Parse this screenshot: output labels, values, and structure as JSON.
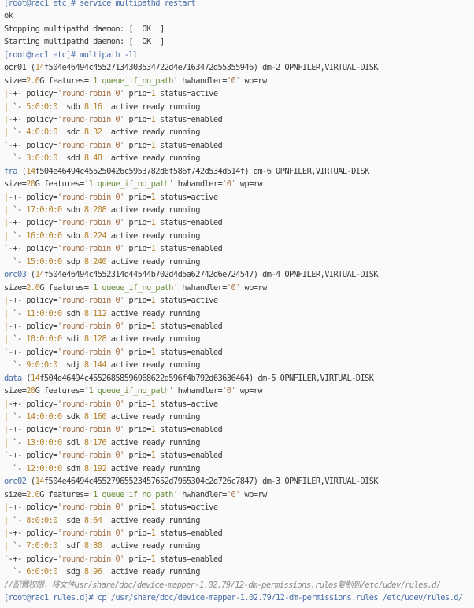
{
  "terminal": {
    "lines": [
      [
        [
          "[root@rac1 etc]# service multipathd restart",
          "p"
        ]
      ],
      [
        [
          "ok",
          "d"
        ]
      ],
      [
        [
          "Stopping multipathd daemon: [  OK  ]",
          "d"
        ]
      ],
      [
        [
          "Starting multipathd daemon: [  OK  ]",
          "d"
        ]
      ],
      [
        [
          "[root@rac1 etc]# multipath -ll",
          "p"
        ]
      ],
      [
        [
          "ocr01 (",
          "d"
        ],
        [
          "14",
          "n"
        ],
        [
          "f504e46494c45527134303534722d4e7163472d55355946) dm-2 OPNFILER,VIRTUAL-DISK",
          "d"
        ]
      ],
      [
        [
          "size=",
          "d"
        ],
        [
          "2.0",
          "n"
        ],
        [
          "G features=",
          "d"
        ],
        [
          "'",
          "q"
        ],
        [
          "1 queue_if_no_path",
          "s"
        ],
        [
          "'",
          "q"
        ],
        [
          " hwhandler=",
          "d"
        ],
        [
          "'0'",
          "q"
        ],
        [
          " wp=rw",
          "d"
        ]
      ],
      [
        [
          "|",
          "b"
        ],
        [
          "-+- policy=",
          "d"
        ],
        [
          "'round-robin 0'",
          "q"
        ],
        [
          " prio=",
          "d"
        ],
        [
          "1",
          "n"
        ],
        [
          " status=active",
          "d"
        ]
      ],
      [
        [
          "|",
          "b"
        ],
        [
          " `- ",
          "d"
        ],
        [
          "5:0:0:0",
          "n"
        ],
        [
          "  sdb ",
          "d"
        ],
        [
          "8:16",
          "n"
        ],
        [
          "  active ready running",
          "d"
        ]
      ],
      [
        [
          "|",
          "b"
        ],
        [
          "-+- policy=",
          "d"
        ],
        [
          "'round-robin 0'",
          "q"
        ],
        [
          " prio=",
          "d"
        ],
        [
          "1",
          "n"
        ],
        [
          " status=enabled",
          "d"
        ]
      ],
      [
        [
          "|",
          "b"
        ],
        [
          " `- ",
          "d"
        ],
        [
          "4:0:0:0",
          "n"
        ],
        [
          "  sdc ",
          "d"
        ],
        [
          "8:32",
          "n"
        ],
        [
          "  active ready running",
          "d"
        ]
      ],
      [
        [
          "`-+- policy=",
          "d"
        ],
        [
          "'round-robin 0'",
          "q"
        ],
        [
          " prio=",
          "d"
        ],
        [
          "1",
          "n"
        ],
        [
          " status=enabled",
          "d"
        ]
      ],
      [
        [
          "  `- ",
          "d"
        ],
        [
          "3:0:0:0",
          "n"
        ],
        [
          "  sdd ",
          "d"
        ],
        [
          "8:48",
          "n"
        ],
        [
          "  active ready running",
          "d"
        ]
      ],
      [
        [
          "fra",
          "p"
        ],
        [
          " (",
          "d"
        ],
        [
          "14",
          "n"
        ],
        [
          "f504e46494c455250426c5953782d6f586f742d534d514f) dm-6 OPNFILER,VIRTUAL-DISK",
          "d"
        ]
      ],
      [
        [
          "size=",
          "d"
        ],
        [
          "20",
          "n"
        ],
        [
          "G features=",
          "d"
        ],
        [
          "'",
          "q"
        ],
        [
          "1 queue_if_no_path",
          "s"
        ],
        [
          "'",
          "q"
        ],
        [
          " hwhandler=",
          "d"
        ],
        [
          "'0'",
          "q"
        ],
        [
          " wp=rw",
          "d"
        ]
      ],
      [
        [
          "|",
          "b"
        ],
        [
          "-+- policy=",
          "d"
        ],
        [
          "'round-robin 0'",
          "q"
        ],
        [
          " prio=",
          "d"
        ],
        [
          "1",
          "n"
        ],
        [
          " status=active",
          "d"
        ]
      ],
      [
        [
          "|",
          "b"
        ],
        [
          " `- ",
          "d"
        ],
        [
          "17:0:0:0",
          "n"
        ],
        [
          " sdn ",
          "d"
        ],
        [
          "8:208",
          "n"
        ],
        [
          " active ready running",
          "d"
        ]
      ],
      [
        [
          "|",
          "b"
        ],
        [
          "-+- policy=",
          "d"
        ],
        [
          "'round-robin 0'",
          "q"
        ],
        [
          " prio=",
          "d"
        ],
        [
          "1",
          "n"
        ],
        [
          " status=enabled",
          "d"
        ]
      ],
      [
        [
          "|",
          "b"
        ],
        [
          " `- ",
          "d"
        ],
        [
          "16:0:0:0",
          "n"
        ],
        [
          " sdo ",
          "d"
        ],
        [
          "8:224",
          "n"
        ],
        [
          " active ready running",
          "d"
        ]
      ],
      [
        [
          "`-+- policy=",
          "d"
        ],
        [
          "'round-robin 0'",
          "q"
        ],
        [
          " prio=",
          "d"
        ],
        [
          "1",
          "n"
        ],
        [
          " status=enabled",
          "d"
        ]
      ],
      [
        [
          "  `- ",
          "d"
        ],
        [
          "15:0:0:0",
          "n"
        ],
        [
          " sdp ",
          "d"
        ],
        [
          "8:240",
          "n"
        ],
        [
          " active ready running",
          "d"
        ]
      ],
      [
        [
          "orc03",
          "p"
        ],
        [
          " (",
          "d"
        ],
        [
          "14",
          "n"
        ],
        [
          "f504e46494c4552314d44544b702d4d5a62742d6e724547) dm-4 OPNFILER,VIRTUAL-DISK",
          "d"
        ]
      ],
      [
        [
          "size=",
          "d"
        ],
        [
          "2.0",
          "n"
        ],
        [
          "G features=",
          "d"
        ],
        [
          "'",
          "q"
        ],
        [
          "1 queue_if_no_path",
          "s"
        ],
        [
          "'",
          "q"
        ],
        [
          " hwhandler=",
          "d"
        ],
        [
          "'0'",
          "q"
        ],
        [
          " wp=rw",
          "d"
        ]
      ],
      [
        [
          "|",
          "b"
        ],
        [
          "-+- policy=",
          "d"
        ],
        [
          "'round-robin 0'",
          "q"
        ],
        [
          " prio=",
          "d"
        ],
        [
          "1",
          "n"
        ],
        [
          " status=active",
          "d"
        ]
      ],
      [
        [
          "|",
          "b"
        ],
        [
          " `- ",
          "d"
        ],
        [
          "11:0:0:0",
          "n"
        ],
        [
          " sdh ",
          "d"
        ],
        [
          "8:112",
          "n"
        ],
        [
          " active ready running",
          "d"
        ]
      ],
      [
        [
          "|",
          "b"
        ],
        [
          "-+- policy=",
          "d"
        ],
        [
          "'round-robin 0'",
          "q"
        ],
        [
          " prio=",
          "d"
        ],
        [
          "1",
          "n"
        ],
        [
          " status=enabled",
          "d"
        ]
      ],
      [
        [
          "|",
          "b"
        ],
        [
          " `- ",
          "d"
        ],
        [
          "10:0:0:0",
          "n"
        ],
        [
          " sdi ",
          "d"
        ],
        [
          "8:128",
          "n"
        ],
        [
          " active ready running",
          "d"
        ]
      ],
      [
        [
          "`-+- policy=",
          "d"
        ],
        [
          "'round-robin 0'",
          "q"
        ],
        [
          " prio=",
          "d"
        ],
        [
          "1",
          "n"
        ],
        [
          " status=enabled",
          "d"
        ]
      ],
      [
        [
          "  `- ",
          "d"
        ],
        [
          "9:0:0:0",
          "n"
        ],
        [
          "  sdj ",
          "d"
        ],
        [
          "8:144",
          "n"
        ],
        [
          " active ready running",
          "d"
        ]
      ],
      [
        [
          "data",
          "p"
        ],
        [
          " (",
          "d"
        ],
        [
          "14",
          "n"
        ],
        [
          "f504e46494c45526858596968622d596f4b792d63636464) dm-5 OPNFILER,VIRTUAL-DISK",
          "d"
        ]
      ],
      [
        [
          "size=",
          "d"
        ],
        [
          "20",
          "n"
        ],
        [
          "G features=",
          "d"
        ],
        [
          "'",
          "q"
        ],
        [
          "1 queue_if_no_path",
          "s"
        ],
        [
          "'",
          "q"
        ],
        [
          " hwhandler=",
          "d"
        ],
        [
          "'0'",
          "q"
        ],
        [
          " wp=rw",
          "d"
        ]
      ],
      [
        [
          "|",
          "b"
        ],
        [
          "-+- policy=",
          "d"
        ],
        [
          "'round-robin 0'",
          "q"
        ],
        [
          " prio=",
          "d"
        ],
        [
          "1",
          "n"
        ],
        [
          " status=active",
          "d"
        ]
      ],
      [
        [
          "|",
          "b"
        ],
        [
          " `- ",
          "d"
        ],
        [
          "14:0:0:0",
          "n"
        ],
        [
          " sdk ",
          "d"
        ],
        [
          "8:160",
          "n"
        ],
        [
          " active ready running",
          "d"
        ]
      ],
      [
        [
          "|",
          "b"
        ],
        [
          "-+- policy=",
          "d"
        ],
        [
          "'round-robin 0'",
          "q"
        ],
        [
          " prio=",
          "d"
        ],
        [
          "1",
          "n"
        ],
        [
          " status=enabled",
          "d"
        ]
      ],
      [
        [
          "|",
          "b"
        ],
        [
          " `- ",
          "d"
        ],
        [
          "13:0:0:0",
          "n"
        ],
        [
          " sdl ",
          "d"
        ],
        [
          "8:176",
          "n"
        ],
        [
          " active ready running",
          "d"
        ]
      ],
      [
        [
          "`-+- policy=",
          "d"
        ],
        [
          "'round-robin 0'",
          "q"
        ],
        [
          " prio=",
          "d"
        ],
        [
          "1",
          "n"
        ],
        [
          " status=enabled",
          "d"
        ]
      ],
      [
        [
          "  `- ",
          "d"
        ],
        [
          "12:0:0:0",
          "n"
        ],
        [
          " sdm ",
          "d"
        ],
        [
          "8:192",
          "n"
        ],
        [
          " active ready running",
          "d"
        ]
      ],
      [
        [
          "orc02",
          "p"
        ],
        [
          " (",
          "d"
        ],
        [
          "14",
          "n"
        ],
        [
          "f504e46494c45527965523457652d7965304c2d726c7847) dm-3 OPNFILER,VIRTUAL-DISK",
          "d"
        ]
      ],
      [
        [
          "size=",
          "d"
        ],
        [
          "2.0",
          "n"
        ],
        [
          "G features=",
          "d"
        ],
        [
          "'",
          "q"
        ],
        [
          "1 queue_if_no_path",
          "s"
        ],
        [
          "'",
          "q"
        ],
        [
          " hwhandler=",
          "d"
        ],
        [
          "'0'",
          "q"
        ],
        [
          " wp=rw",
          "d"
        ]
      ],
      [
        [
          "|",
          "b"
        ],
        [
          "-+- policy=",
          "d"
        ],
        [
          "'round-robin 0'",
          "q"
        ],
        [
          " prio=",
          "d"
        ],
        [
          "1",
          "n"
        ],
        [
          " status=active",
          "d"
        ]
      ],
      [
        [
          "|",
          "b"
        ],
        [
          " `- ",
          "d"
        ],
        [
          "8:0:0:0",
          "n"
        ],
        [
          "  sde ",
          "d"
        ],
        [
          "8:64",
          "n"
        ],
        [
          "  active ready running",
          "d"
        ]
      ],
      [
        [
          "|",
          "b"
        ],
        [
          "-+- policy=",
          "d"
        ],
        [
          "'round-robin 0'",
          "q"
        ],
        [
          " prio=",
          "d"
        ],
        [
          "1",
          "n"
        ],
        [
          " status=enabled",
          "d"
        ]
      ],
      [
        [
          "|",
          "b"
        ],
        [
          " `- ",
          "d"
        ],
        [
          "7:0:0:0",
          "n"
        ],
        [
          "  sdf ",
          "d"
        ],
        [
          "8:80",
          "n"
        ],
        [
          "  active ready running",
          "d"
        ]
      ],
      [
        [
          "`-+- policy=",
          "d"
        ],
        [
          "'round-robin 0'",
          "q"
        ],
        [
          " prio=",
          "d"
        ],
        [
          "1",
          "n"
        ],
        [
          " status=enabled",
          "d"
        ]
      ],
      [
        [
          "  `- ",
          "d"
        ],
        [
          "6:0:0:0",
          "n"
        ],
        [
          "  sdg ",
          "d"
        ],
        [
          "8:96",
          "n"
        ],
        [
          "  active ready running",
          "d"
        ]
      ],
      [
        [
          "//配置权限，将文件usr/share/doc/device-mapper-1.02.79/12-dm-permissions.rules复制到/etc/udev/rules.d/",
          "c"
        ]
      ],
      [
        [
          "[root@rac1 rules.d]# cp /usr/share/doc/device-mapper-1.02.79/12-dm-permissions.rules /etc/udev/rules.d/",
          "p"
        ]
      ]
    ]
  },
  "colors": {
    "prompt": "#4a6ea8",
    "number": "#b5832d",
    "string": "#6a8f3b",
    "quote": "#a3714a",
    "text": "#3a3a3a",
    "comment": "#8a8a8a",
    "background": "#fafafa"
  }
}
